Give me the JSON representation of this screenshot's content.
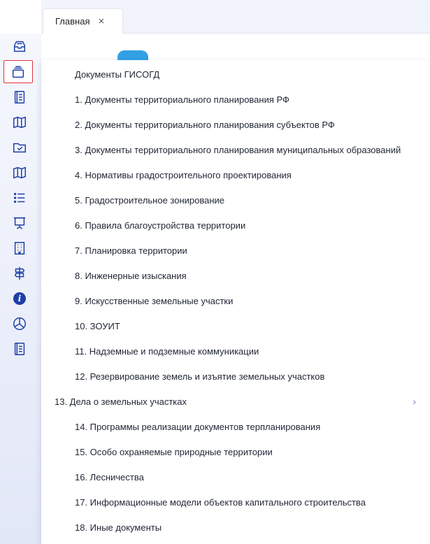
{
  "tab": {
    "label": "Главная",
    "close": "×"
  },
  "sidebar": {
    "icons": [
      "inbox-icon",
      "layers-icon",
      "document-list-icon",
      "map-icon",
      "folder-check-icon",
      "map-icon",
      "list-icon",
      "presentation-board-icon",
      "building-icon",
      "signpost-icon",
      "info-icon",
      "pie-chart-icon",
      "document-list-icon"
    ],
    "active_index": 1
  },
  "menu": {
    "items": [
      {
        "label": "Документы ГИСОГД"
      },
      {
        "label": "1. Документы территориального планирования РФ"
      },
      {
        "label": "2. Документы территориального планирования субъектов РФ"
      },
      {
        "label": "3. Документы территориального планирования муниципальных образований"
      },
      {
        "label": "4. Нормативы градостроительного проектирования"
      },
      {
        "label": "5. Градостроительное зонирование"
      },
      {
        "label": "6. Правила благоустройства территории"
      },
      {
        "label": "7. Планировка территории"
      },
      {
        "label": "8. Инженерные изыскания"
      },
      {
        "label": "9. Искусственные земельные участки"
      },
      {
        "label": "10. ЗОУИТ"
      },
      {
        "label": "11. Надземные и подземные коммуникации"
      },
      {
        "label": "12. Резервирование земель и изъятие земельных участков"
      },
      {
        "label": "13. Дела о земельных участках",
        "has_submenu": true
      },
      {
        "label": "14. Программы реализации документов терпланирования"
      },
      {
        "label": "15. Особо охраняемые природные территории"
      },
      {
        "label": "16. Лесничества"
      },
      {
        "label": "17. Информационные модели объектов капитального строительства"
      },
      {
        "label": "18. Иные документы"
      }
    ],
    "submenu_chevron": "›"
  },
  "colors": {
    "accent": "#1d3fa8",
    "active_border": "#e0353f"
  }
}
